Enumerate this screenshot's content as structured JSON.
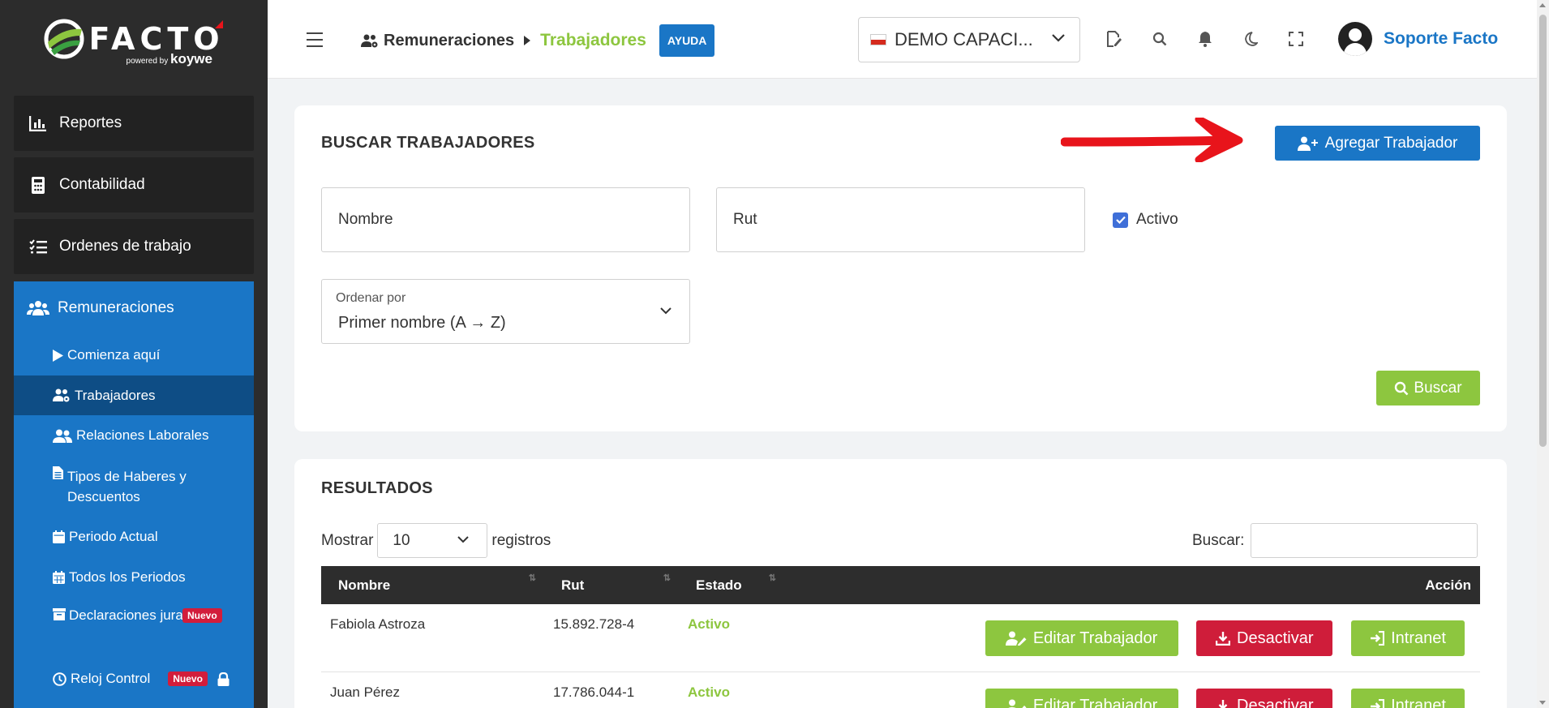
{
  "brand": {
    "name": "FACTO",
    "powered_by": "powered by",
    "powered_brand": "koywe"
  },
  "sidebar": {
    "items": [
      {
        "label": "Reportes",
        "icon": "bar-chart-icon"
      },
      {
        "label": "Contabilidad",
        "icon": "calculator-icon"
      },
      {
        "label": "Ordenes de trabajo",
        "icon": "checklist-icon"
      }
    ],
    "remuneraciones": {
      "label": "Remuneraciones",
      "icon": "users-icon",
      "children": [
        {
          "label": "Comienza aquí",
          "icon": "play-icon"
        },
        {
          "label": "Trabajadores",
          "icon": "users-gear-icon",
          "active": true
        },
        {
          "label": "Relaciones Laborales",
          "icon": "user-group-icon"
        },
        {
          "label": "Tipos de Haberes y Descuentos",
          "icon": "file-icon"
        },
        {
          "label": "Periodo Actual",
          "icon": "calendar-icon"
        },
        {
          "label": "Todos los Periodos",
          "icon": "calendar-grid-icon"
        },
        {
          "label": "Declaraciones juradas",
          "icon": "archive-icon",
          "badge": "Nuevo"
        },
        {
          "label": "Reloj Control",
          "icon": "clock-icon",
          "badge": "Nuevo",
          "locked": true
        }
      ]
    }
  },
  "header": {
    "breadcrumb": {
      "section": "Remuneraciones",
      "page": "Trabajadores"
    },
    "help_label": "AYUDA",
    "company": {
      "name": "DEMO CAPACI...",
      "flag": "chile-flag-icon"
    },
    "icons": [
      "document-edit-icon",
      "search-icon",
      "bell-icon",
      "moon-icon",
      "fullscreen-icon"
    ],
    "user_name": "Soporte Facto"
  },
  "search_panel": {
    "title": "BUSCAR TRABAJADORES",
    "add_button": "Agregar Trabajador",
    "name_placeholder": "Nombre",
    "rut_placeholder": "Rut",
    "active_label": "Activo",
    "active_checked": true,
    "order_label": "Ordenar por",
    "order_value": "Primer nombre (A → Z)",
    "search_button": "Buscar"
  },
  "results": {
    "title": "RESULTADOS",
    "show_label": "Mostrar",
    "page_size": "10",
    "records_label": "registros",
    "filter_label": "Buscar:",
    "columns": [
      "Nombre",
      "Rut",
      "Estado",
      "Acción"
    ],
    "rows": [
      {
        "name": "Fabiola Astroza",
        "rut": "15.892.728-4",
        "status": "Activo"
      },
      {
        "name": "Juan Pérez",
        "rut": "17.786.044-1",
        "status": "Activo"
      }
    ],
    "actions": {
      "edit": "Editar Trabajador",
      "deactivate": "Desactivar",
      "intranet": "Intranet"
    }
  },
  "colors": {
    "primary": "#1a76c6",
    "success": "#8dc63f",
    "danger": "#cf1d3a",
    "sidebar_bg": "#2c2c2c",
    "annotation_arrow": "#e8141b"
  }
}
